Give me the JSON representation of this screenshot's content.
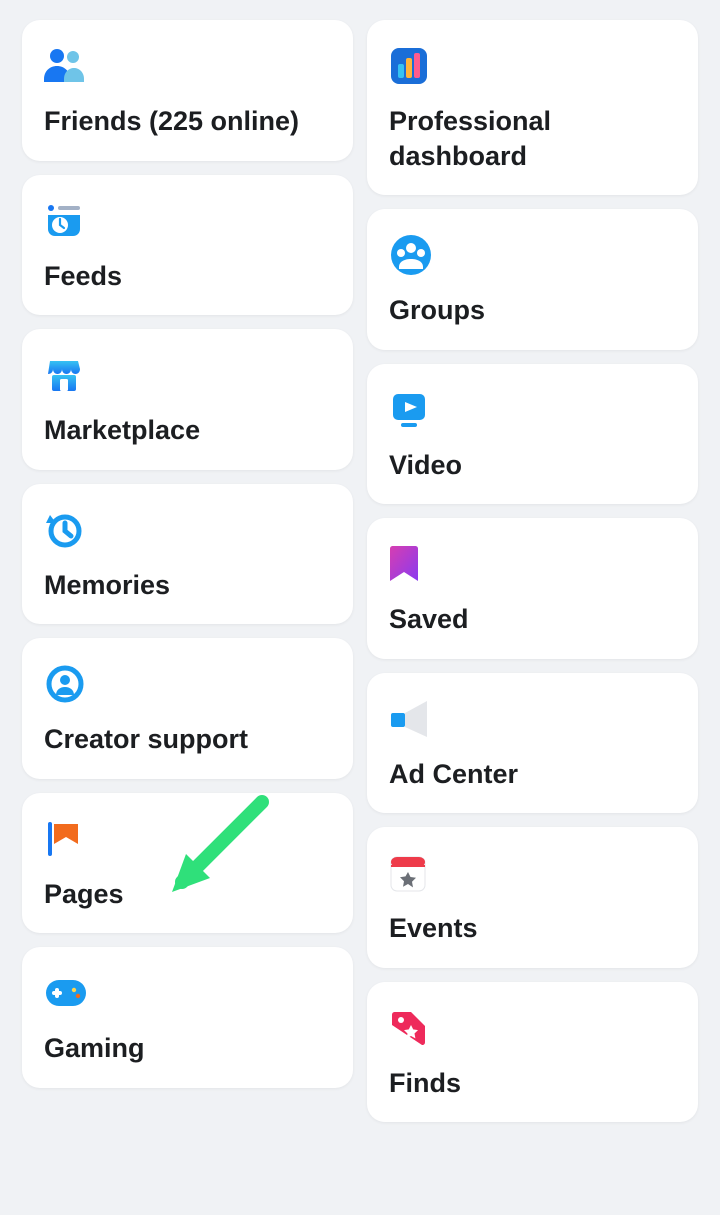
{
  "menu": {
    "left": [
      {
        "key": "friends",
        "label": "Friends (225 online)",
        "icon": "friends-icon"
      },
      {
        "key": "feeds",
        "label": "Feeds",
        "icon": "feeds-icon"
      },
      {
        "key": "marketplace",
        "label": "Marketplace",
        "icon": "marketplace-icon"
      },
      {
        "key": "memories",
        "label": "Memories",
        "icon": "memories-icon"
      },
      {
        "key": "creator-support",
        "label": "Creator support",
        "icon": "creator-support-icon"
      },
      {
        "key": "pages",
        "label": "Pages",
        "icon": "pages-icon"
      },
      {
        "key": "gaming",
        "label": "Gaming",
        "icon": "gaming-icon"
      }
    ],
    "right": [
      {
        "key": "professional-dashboard",
        "label": "Professional dashboard",
        "icon": "dashboard-icon"
      },
      {
        "key": "groups",
        "label": "Groups",
        "icon": "groups-icon"
      },
      {
        "key": "video",
        "label": "Video",
        "icon": "video-icon"
      },
      {
        "key": "saved",
        "label": "Saved",
        "icon": "saved-icon"
      },
      {
        "key": "ad-center",
        "label": "Ad Center",
        "icon": "ad-center-icon"
      },
      {
        "key": "events",
        "label": "Events",
        "icon": "events-icon"
      },
      {
        "key": "finds",
        "label": "Finds",
        "icon": "finds-icon"
      }
    ]
  },
  "annotation": {
    "arrow_target": "pages",
    "arrow_color": "#2fe07a"
  }
}
